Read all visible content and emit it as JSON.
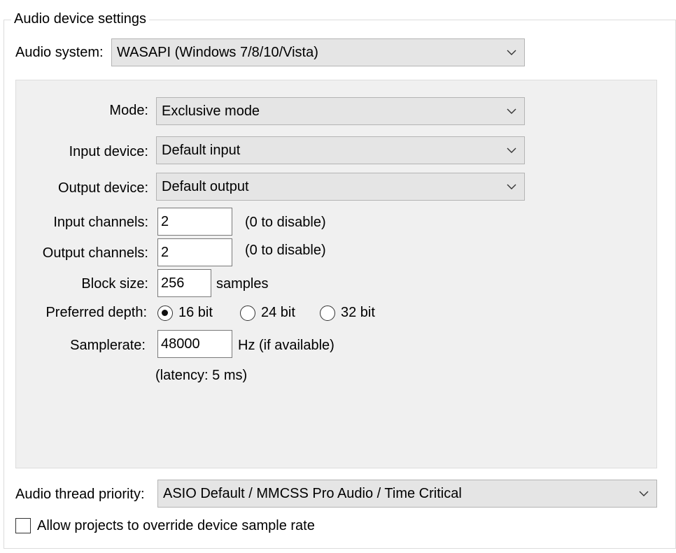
{
  "group": {
    "title": "Audio device settings"
  },
  "audio_system": {
    "label": "Audio system:",
    "value": "WASAPI (Windows 7/8/10/Vista)"
  },
  "mode": {
    "label": "Mode:",
    "value": "Exclusive mode"
  },
  "input_device": {
    "label": "Input device:",
    "value": "Default input"
  },
  "output_device": {
    "label": "Output device:",
    "value": "Default output"
  },
  "input_channels": {
    "label": "Input channels:",
    "value": "2",
    "hint": "(0 to disable)"
  },
  "output_channels": {
    "label": "Output channels:",
    "value": "2",
    "hint": "(0 to disable)"
  },
  "block_size": {
    "label": "Block size:",
    "value": "256",
    "unit": "samples"
  },
  "preferred_depth": {
    "label": "Preferred depth:",
    "options": [
      "16 bit",
      "24 bit",
      "32 bit"
    ],
    "selected": "16 bit"
  },
  "samplerate": {
    "label": "Samplerate:",
    "value": "48000",
    "unit": "Hz (if available)"
  },
  "latency": "(latency: 5 ms)",
  "thread_priority": {
    "label": "Audio thread priority:",
    "value": "ASIO Default / MMCSS Pro Audio / Time Critical"
  },
  "override_sample_rate": {
    "label": "Allow projects to override device sample rate",
    "checked": false
  },
  "icons": {
    "dropdown": "chevron-down-icon"
  }
}
